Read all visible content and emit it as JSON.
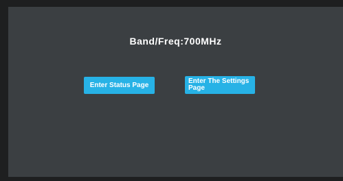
{
  "header": {
    "band_freq": "Band/Freq:700MHz"
  },
  "buttons": {
    "status": "Enter Status Page",
    "settings": "Enter The Settings Page"
  },
  "colors": {
    "background": "#3b3f42",
    "frame": "#1e1f20",
    "button": "#27b2e6",
    "text": "#ffffff"
  }
}
